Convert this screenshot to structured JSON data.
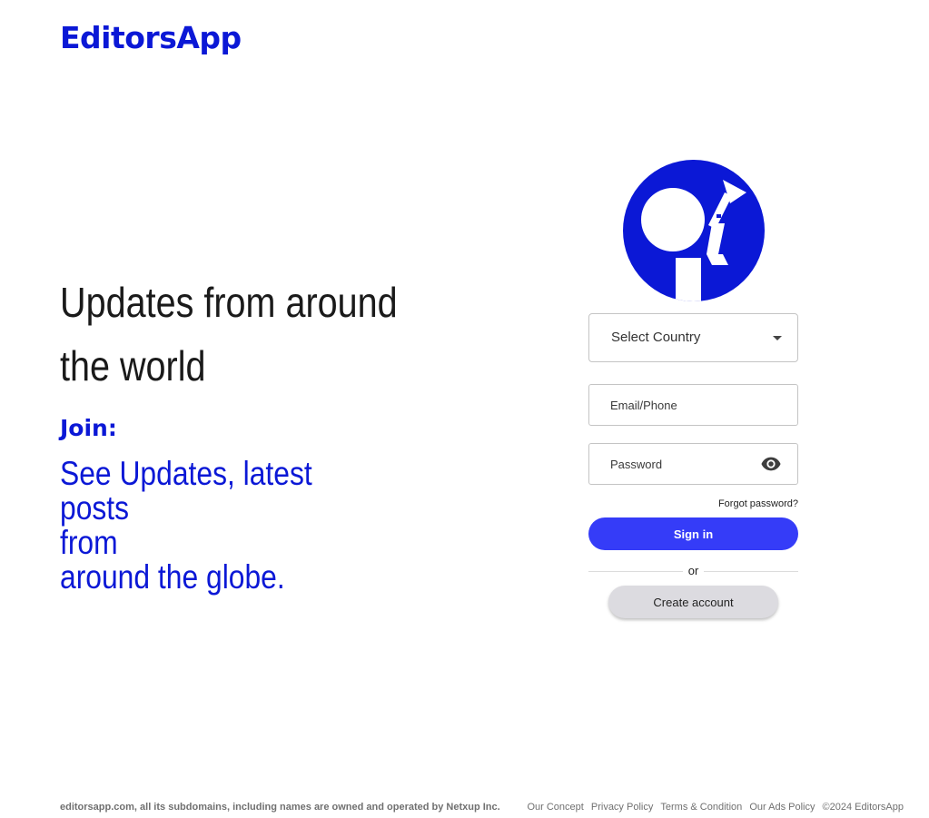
{
  "brand": {
    "name": "EditorsApp",
    "color": "#0b18d6"
  },
  "hero": {
    "title": "Updates from around the world",
    "join_label": "Join:",
    "join_lines": [
      "See Updates, latest posts",
      "from",
      "around the globe."
    ]
  },
  "login": {
    "country_select": {
      "selected": "Select Country"
    },
    "email": {
      "placeholder": "Email/Phone",
      "value": ""
    },
    "password": {
      "placeholder": "Password",
      "value": ""
    },
    "forgot_label": "Forgot password?",
    "signin_label": "Sign in",
    "or_label": "or",
    "create_label": "Create account",
    "accent_color": "#353cf8"
  },
  "footer": {
    "ownership": "editorsapp.com, all its subdomains, including names are owned and operated by Netxup Inc.",
    "links": [
      "Our Concept",
      "Privacy Policy",
      "Terms & Condition",
      "Our Ads Policy"
    ],
    "copyright": "©2024 EditorsApp"
  }
}
